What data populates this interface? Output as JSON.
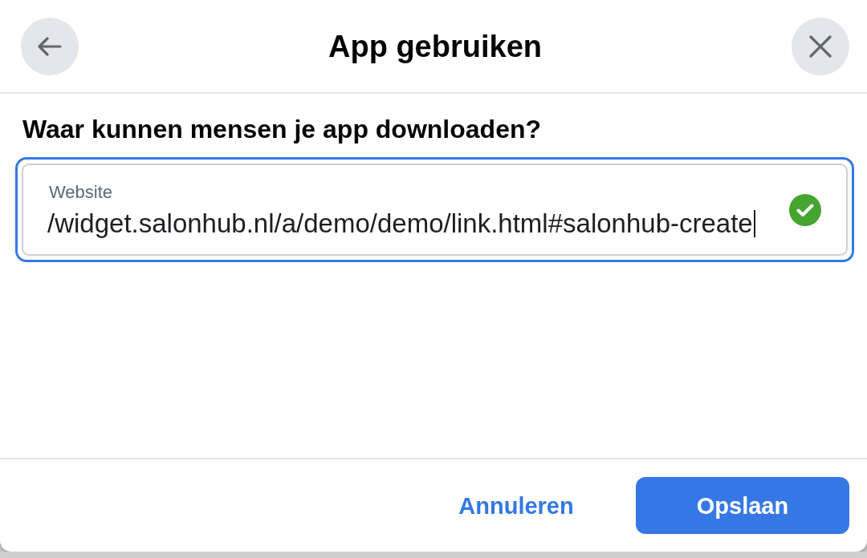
{
  "dialog": {
    "title": "App gebruiken",
    "question": "Waar kunnen mensen je app downloaden?",
    "website_field": {
      "label": "Website",
      "value": "/widget.salonhub.nl/a/demo/demo/link.html#salonhub-create",
      "focused": true,
      "valid": true
    },
    "buttons": [
      {
        "label": "Annuleren",
        "kind": "secondary"
      },
      {
        "label": "Opslaan",
        "kind": "primary"
      }
    ]
  }
}
